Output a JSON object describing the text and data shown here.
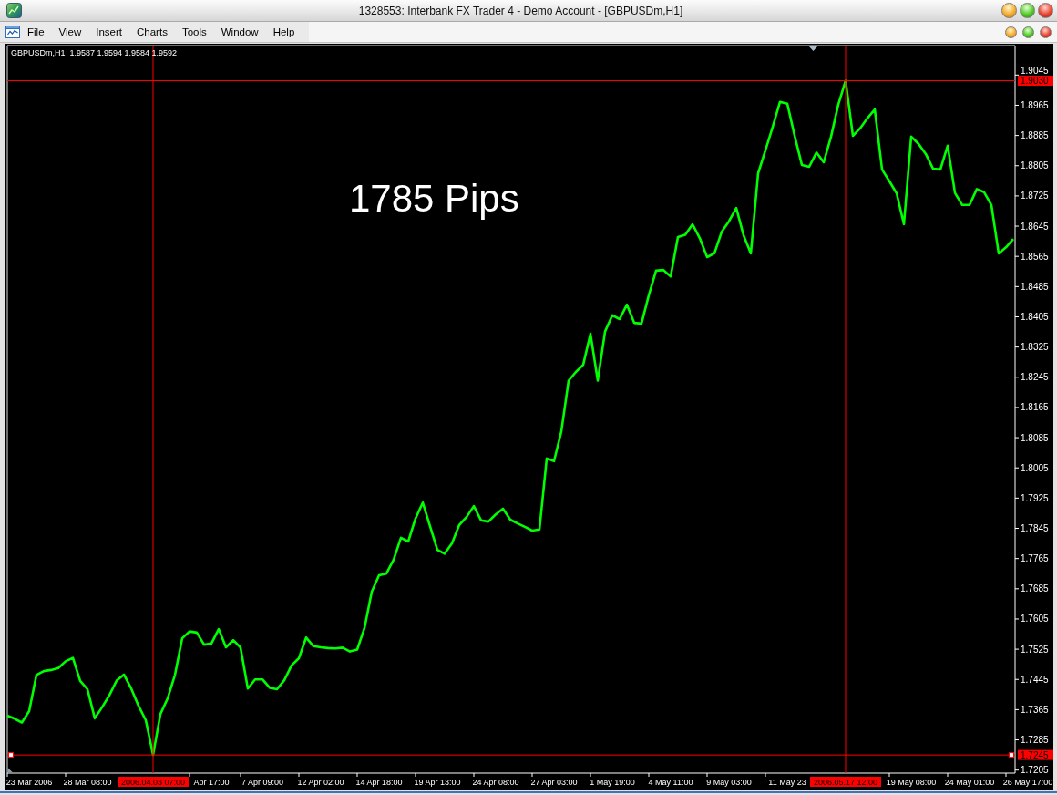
{
  "window": {
    "title": "1328553: Interbank FX Trader 4 - Demo Account - [GBPUSDm,H1]",
    "controls": [
      {
        "kind": "minimize"
      },
      {
        "kind": "maximize"
      },
      {
        "kind": "close"
      }
    ]
  },
  "menu_bar": {
    "items": [
      "File",
      "View",
      "Insert",
      "Charts",
      "Tools",
      "Window",
      "Help"
    ],
    "window_controls": [
      {
        "kind": "minimize"
      },
      {
        "kind": "maximize"
      },
      {
        "kind": "close"
      }
    ]
  },
  "chart": {
    "quotes": [
      "1.9587",
      "1.9594",
      "1.9584",
      "1.9592"
    ],
    "vertical_lines": [
      {
        "kind": "low",
        "label": "2006.04.03 07:00",
        "selected": false
      },
      {
        "kind": "high",
        "label": "2006.05.17 12:00",
        "selected": false
      }
    ],
    "horizontal_lines": [
      {
        "selected": false
      },
      {
        "selected": true
      }
    ],
    "chart_data": {
      "type": "line",
      "categories": [
        null,
        null,
        null,
        "23 Mar 2006",
        null,
        null,
        null,
        null,
        null,
        null,
        null,
        "28 Mar 08:00",
        null,
        null,
        null,
        null,
        null,
        null,
        null,
        null,
        null,
        null,
        null,
        null,
        null,
        null,
        null,
        null,
        "Apr 17:00",
        null,
        null,
        null,
        null,
        null,
        null,
        "7 Apr 09:00",
        null,
        null,
        null,
        null,
        null,
        null,
        null,
        "12 Apr 02:00",
        null,
        null,
        null,
        null,
        null,
        null,
        null,
        "14 Apr 18:00",
        null,
        null,
        null,
        null,
        null,
        null,
        null,
        "19 Apr 13:00",
        null,
        null,
        null,
        null,
        null,
        null,
        null,
        "24 Apr 08:00",
        null,
        null,
        null,
        null,
        null,
        null,
        null,
        "27 Apr 03:00",
        null,
        null,
        null,
        null,
        null,
        null,
        null,
        "1 May 19:00",
        null,
        null,
        null,
        null,
        null,
        null,
        null,
        "4 May 11:00",
        null,
        null,
        null,
        null,
        null,
        null,
        null,
        "9 May 03:00",
        null,
        null,
        null,
        null,
        null,
        null,
        null,
        "11 May 23",
        null,
        null,
        null,
        null,
        null,
        null,
        null,
        null,
        null,
        null,
        null,
        null,
        null,
        null,
        null,
        null,
        "19 May 08:00",
        null,
        null,
        null,
        null,
        null,
        null,
        null,
        "24 May 01:00",
        null,
        null,
        null,
        null,
        null,
        null,
        null,
        "26 May 17:00"
      ],
      "series": [
        {
          "name": "GBPUSDm,H1",
          "color": "#00ff00",
          "values": [
            1.7349,
            1.7341,
            1.7331,
            1.7361,
            1.7457,
            1.7467,
            1.747,
            1.7475,
            1.7493,
            1.7502,
            1.7441,
            1.7419,
            1.7342,
            1.7371,
            1.7403,
            1.7442,
            1.7458,
            1.7421,
            1.7375,
            1.7337,
            1.7245,
            1.7353,
            1.7395,
            1.7457,
            1.7554,
            1.7572,
            1.7569,
            1.7537,
            1.754,
            1.7578,
            1.753,
            1.7549,
            1.7529,
            1.7421,
            1.7445,
            1.7445,
            1.7423,
            1.7419,
            1.7443,
            1.7482,
            1.7501,
            1.7556,
            1.7533,
            1.753,
            1.7528,
            1.7527,
            1.7529,
            1.7519,
            1.7524,
            1.7581,
            1.7677,
            1.7721,
            1.7725,
            1.7762,
            1.782,
            1.781,
            1.7871,
            1.7913,
            1.785,
            1.7788,
            1.7778,
            1.7805,
            1.7854,
            1.7875,
            1.7904,
            1.7866,
            1.7863,
            1.7882,
            1.7897,
            1.7868,
            1.7858,
            1.7849,
            1.7839,
            1.7842,
            1.803,
            1.8023,
            1.8101,
            1.8236,
            1.8259,
            1.8278,
            1.836,
            1.8236,
            1.8366,
            1.8409,
            1.8399,
            1.8437,
            1.8389,
            1.8387,
            1.8462,
            1.8527,
            1.8529,
            1.8512,
            1.8616,
            1.8622,
            1.865,
            1.8613,
            1.8563,
            1.8573,
            1.863,
            1.8658,
            1.8693,
            1.8621,
            1.8573,
            1.8785,
            1.8846,
            1.8908,
            1.8974,
            1.8969,
            1.8885,
            1.8807,
            1.8802,
            1.884,
            1.8814,
            1.8882,
            1.8967,
            1.903,
            1.8884,
            1.8904,
            1.8931,
            1.8954,
            1.8795,
            1.8764,
            1.8732,
            1.865,
            1.8882,
            1.8863,
            1.8836,
            1.8797,
            1.8795,
            1.8858,
            1.8733,
            1.8701,
            1.8701,
            1.8743,
            1.8735,
            1.8701,
            1.8573,
            1.8589,
            1.8611,
            null,
            null
          ]
        }
      ],
      "ylim": [
        1.7197,
        1.9123
      ],
      "yticks": [
        1.9045,
        1.8965,
        1.8885,
        1.8805,
        1.8725,
        1.8645,
        1.8565,
        1.8485,
        1.8405,
        1.8325,
        1.8245,
        1.8165,
        1.8085,
        1.8005,
        1.7925,
        1.7845,
        1.7765,
        1.7685,
        1.7605,
        1.7525,
        1.7445,
        1.7365,
        1.7285,
        1.7205
      ],
      "ref_lines": [
        {
          "axis": "y",
          "value": 1.903,
          "label": "1.9030"
        },
        {
          "axis": "y",
          "value": 1.7245,
          "label": "1.7245"
        }
      ],
      "annotations": [
        "1785 Pips"
      ]
    }
  }
}
